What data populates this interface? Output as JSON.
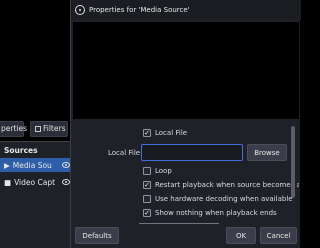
{
  "obs": {
    "properties_button_label": "perties",
    "filters_button_label": "Filters",
    "sources_title": "Sources",
    "sources": [
      {
        "name": "Media Sou",
        "selected": true,
        "icon": "play-icon"
      },
      {
        "name": "Video Capt",
        "selected": false,
        "icon": "camera-icon"
      }
    ]
  },
  "dialog": {
    "title": "Properties for 'Media Source'",
    "local_file_checkbox": {
      "label": "Local File",
      "checked": true
    },
    "local_file_field": {
      "label": "Local File",
      "value": "",
      "button": "Browse"
    },
    "options": [
      {
        "label": "Loop",
        "checked": false
      },
      {
        "label": "Restart playback when source becomes acti",
        "checked": true
      },
      {
        "label": "Use hardware decoding when available",
        "checked": false
      },
      {
        "label": "Show nothing when playback ends",
        "checked": true
      }
    ],
    "buttons": {
      "defaults": "Defaults",
      "ok": "OK",
      "cancel": "Cancel"
    },
    "colors": {
      "accent": "#3f6fd8",
      "selection": "#2f5ea8",
      "background": "#1f2128"
    }
  }
}
